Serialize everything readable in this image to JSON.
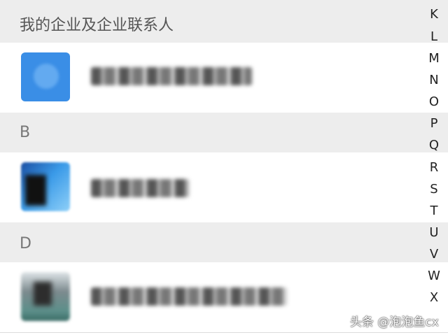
{
  "sections": [
    {
      "header": "我的企业及企业联系人",
      "contacts": [
        {
          "name": "■■■■■■■■■"
        }
      ]
    },
    {
      "header": "B",
      "contacts": [
        {
          "name": "■■■■■■"
        }
      ]
    },
    {
      "header": "D",
      "contacts": [
        {
          "name": "■■■■■ · ■■■■■■"
        }
      ]
    }
  ],
  "index_letters": [
    "K",
    "L",
    "M",
    "N",
    "O",
    "P",
    "Q",
    "R",
    "S",
    "T",
    "U",
    "V",
    "W",
    "X"
  ],
  "watermark": "头条 @泡泡鱼cx"
}
